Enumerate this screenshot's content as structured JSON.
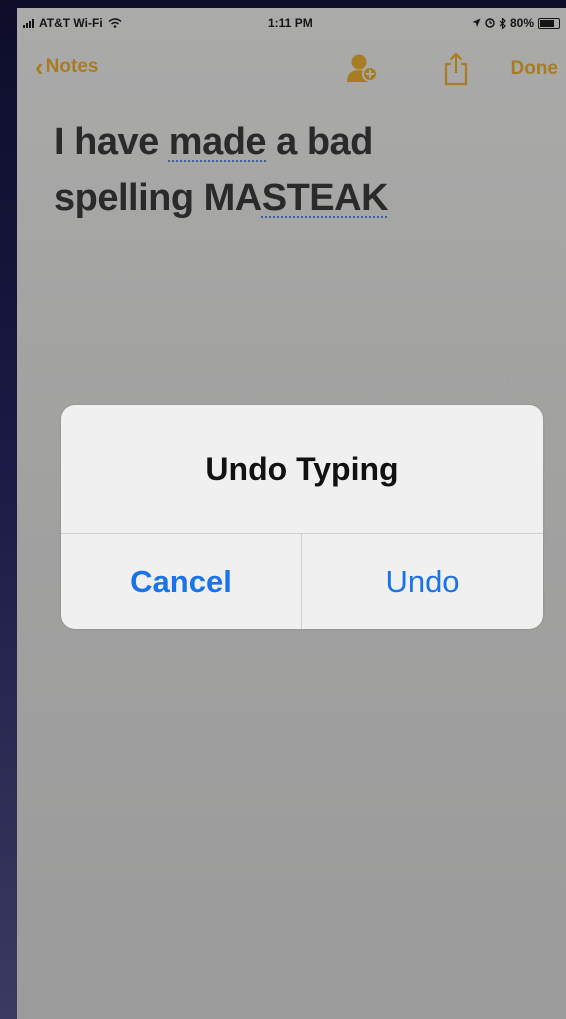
{
  "status_bar": {
    "carrier": "AT&T Wi-Fi",
    "time": "1:11 PM",
    "battery": "80%"
  },
  "nav": {
    "back_label": "Notes",
    "done_label": "Done",
    "accent_color": "#a87c22"
  },
  "note": {
    "line1_prefix": "I have ",
    "line1_misspelled": "made",
    "line1_suffix": " a bad",
    "line2_prefix": "spelling MA",
    "line2_misspelled": "STEAK"
  },
  "alert": {
    "title": "Undo Typing",
    "cancel_label": "Cancel",
    "undo_label": "Undo",
    "button_color": "#1a73e8"
  },
  "icons": [
    "wifi-icon",
    "location-icon",
    "bluetooth-icon",
    "battery-icon",
    "back-chevron-icon",
    "add-people-icon",
    "share-icon"
  ]
}
